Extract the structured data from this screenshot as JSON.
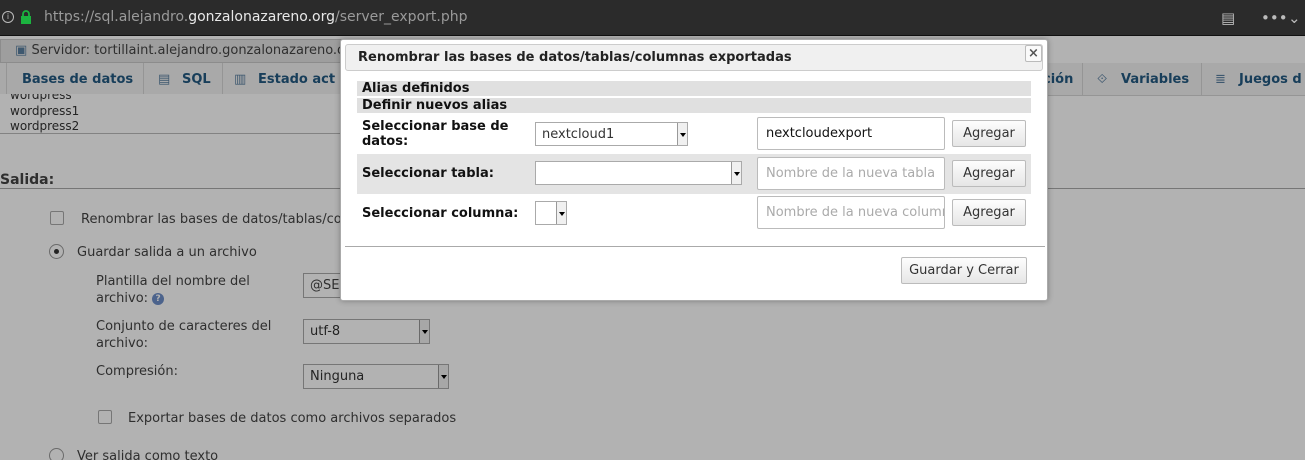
{
  "browser": {
    "url_prefix": "https://sql.alejandro.",
    "url_domain": "gonzalonazareno.org",
    "url_path": "/server_export.php"
  },
  "server_tab": {
    "label": "Servidor: tortillaint.alejandro.gonzalonazareno.org"
  },
  "nav": {
    "items": [
      {
        "label": "Bases de datos",
        "icon": "database-icon"
      },
      {
        "label": "SQL",
        "icon": "sql-icon"
      },
      {
        "label": "Estado act",
        "icon": "status-icon"
      },
      {
        "label": "ción",
        "icon": ""
      },
      {
        "label": "Variables",
        "icon": "variables-icon"
      },
      {
        "label": "Juegos d",
        "icon": "charset-icon"
      }
    ]
  },
  "db_list": [
    "wordpress",
    "wordpress1",
    "wordpress2"
  ],
  "output": {
    "heading": "Salida:",
    "rename_label": "Renombrar las bases de datos/tablas/co",
    "save_to_file_label": "Guardar salida a un archivo",
    "filename_template_label": "Plantilla del nombre del archivo:",
    "filename_template_value": "@SEF",
    "charset_label": "Conjunto de caracteres del archivo:",
    "charset_value": "utf-8",
    "compression_label": "Compresión:",
    "compression_value": "Ninguna",
    "separate_files_label": "Exportar bases de datos como archivos separados",
    "view_as_text_label": "Ver salida como texto"
  },
  "dialog": {
    "title": "Renombrar las bases de datos/tablas/columnas exportadas",
    "close_symbol": "×",
    "defined_aliases_heading": "Alias definidos",
    "new_aliases_heading": "Definir nuevos alias",
    "rows": [
      {
        "label": "Seleccionar base de datos:",
        "select_value": "nextcloud1",
        "input_value": "nextcloudexport",
        "input_placeholder": "",
        "button": "Agregar"
      },
      {
        "label": "Seleccionar tabla:",
        "select_value": "",
        "input_value": "",
        "input_placeholder": "Nombre de la nueva tabla",
        "button": "Agregar"
      },
      {
        "label": "Seleccionar columna:",
        "select_value": "",
        "input_value": "",
        "input_placeholder": "Nombre de la nueva columna",
        "button": "Agregar"
      }
    ],
    "save_close_button": "Guardar y Cerrar"
  }
}
